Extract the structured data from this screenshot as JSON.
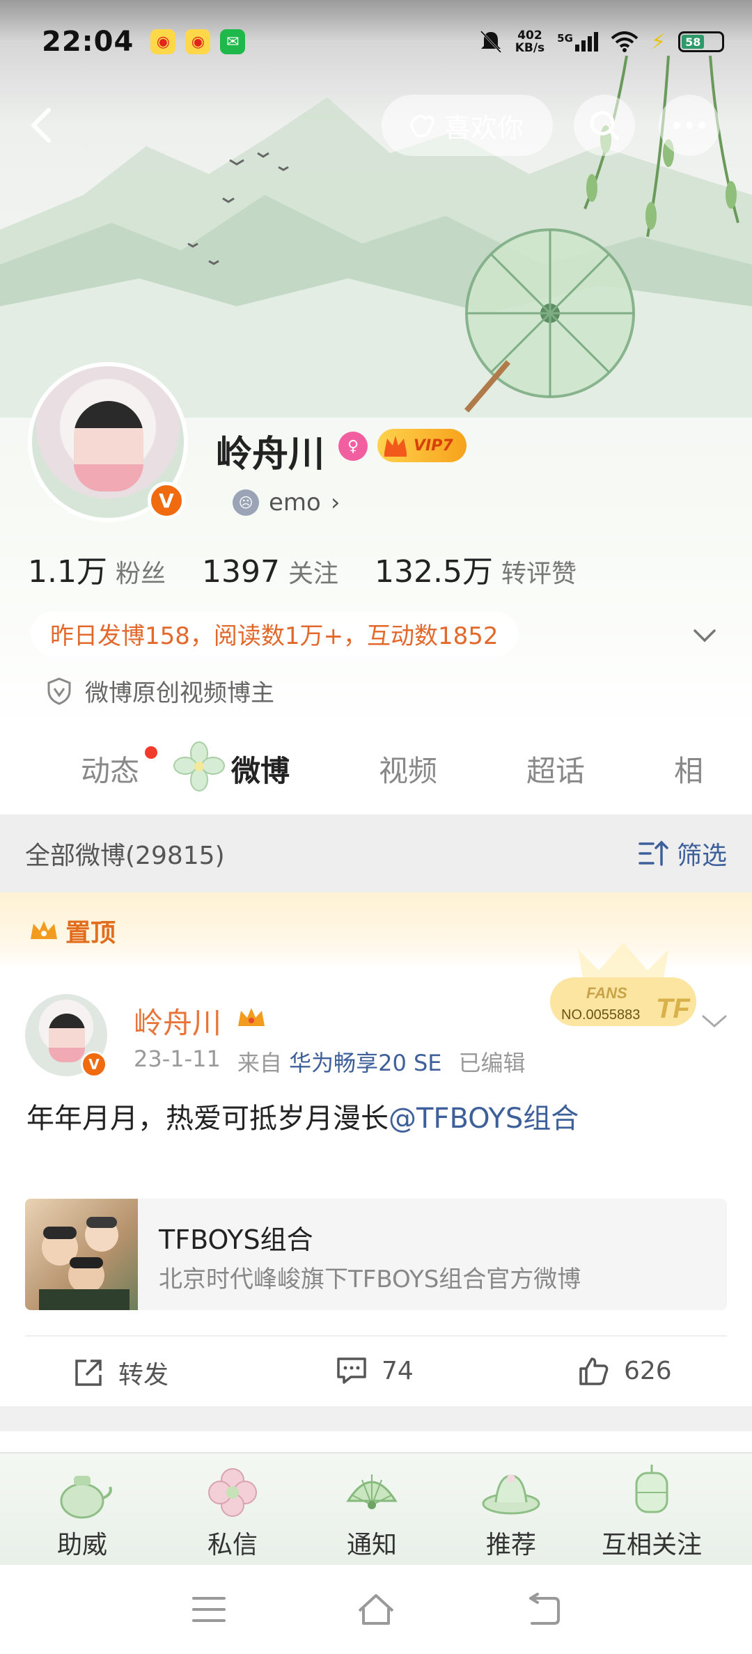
{
  "status_bar": {
    "time": "22:04",
    "net_speed_top": "402",
    "net_speed_bottom": "KB/s",
    "signal_label": "5G",
    "battery": "58"
  },
  "nav": {
    "like_label": "喜欢你"
  },
  "profile": {
    "name": "岭舟川",
    "vip_label": "VIP7",
    "mood": "emo",
    "mood_chevron": "›",
    "verify_mark": "V",
    "stats": [
      {
        "num": "1.1万",
        "label": "粉丝"
      },
      {
        "num": "1397",
        "label": "关注"
      },
      {
        "num": "132.5万",
        "label": "转评赞"
      }
    ],
    "summary": "昨日发博158，阅读数1万+，互动数1852",
    "certification": "微博原创视频博主"
  },
  "tabs": [
    {
      "label": "动态"
    },
    {
      "label": "微博"
    },
    {
      "label": "视频"
    },
    {
      "label": "超话"
    },
    {
      "label": "相"
    }
  ],
  "filter": {
    "count_label": "全部微博(29815)",
    "button_label": "筛选"
  },
  "pinned": {
    "label": "置顶"
  },
  "post": {
    "author": "岭舟川",
    "date": "23-1-11",
    "source_prefix": "来自",
    "source": "华为畅享20 SE",
    "edited": "已编辑",
    "text": "年年月月，热爱可抵岁月漫长",
    "mention": "@TFBOYS组合",
    "fans_badge_top": "FANS",
    "fans_badge_no": "NO.0055883",
    "link_card": {
      "title": "TFBOYS组合",
      "desc": "北京时代峰峻旗下TFBOYS组合官方微博"
    },
    "actions": {
      "repost": "转发",
      "comments": "74",
      "likes": "626"
    }
  },
  "bottom_bar": [
    {
      "label": "助威"
    },
    {
      "label": "私信"
    },
    {
      "label": "通知"
    },
    {
      "label": "推荐"
    },
    {
      "label": "互相关注"
    }
  ]
}
